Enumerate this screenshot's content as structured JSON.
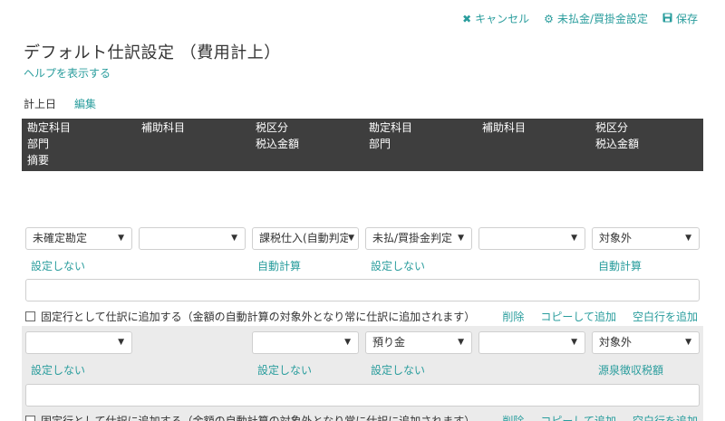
{
  "toolbar": {
    "cancel_label": "キャンセル",
    "unpaid_settings_label": "未払金/買掛金設定",
    "save_label": "保存"
  },
  "page": {
    "title": "デフォルト仕訳設定 （費用計上）",
    "help_label": "ヘルプを表示する",
    "date_label": "計上日",
    "edit_label": "編集"
  },
  "table_header": {
    "debit_account": "勘定科目",
    "debit_sub": "補助科目",
    "debit_tax": "税区分",
    "dept": "部門",
    "tax_included": "税込金額",
    "memo": "摘要",
    "credit_account": "勘定科目",
    "credit_sub": "補助科目",
    "credit_tax": "税区分",
    "credit_dept": "部門",
    "credit_tax_included": "税込金額"
  },
  "rows": [
    {
      "debit_account": "未確定勘定",
      "debit_sub": "",
      "debit_tax": "課税仕入(自動判定",
      "credit_account": "未払/買掛金判定",
      "credit_sub": "",
      "credit_tax": "対象外",
      "debit_dept": "設定しない",
      "debit_amount": "自動計算",
      "credit_dept": "設定しない",
      "credit_amount": "自動計算",
      "fixed_label": "固定行として仕訳に追加する（金額の自動計算の対象外となり常に仕訳に追加されます）",
      "delete_label": "削除",
      "copy_label": "コピーして追加",
      "add_blank_label": "空白行を追加"
    },
    {
      "debit_account": "",
      "debit_tax": "",
      "credit_account": "預り金",
      "credit_sub": "",
      "credit_tax": "対象外",
      "debit_dept": "設定しない",
      "debit_amount": "設定しない",
      "credit_dept": "設定しない",
      "credit_amount": "源泉徴収税額",
      "fixed_label": "固定行として仕訳に追加する（金額の自動計算の対象外となり常に仕訳に追加されます）",
      "delete_label": "削除",
      "copy_label": "コピーして追加",
      "add_blank_label": "空白行を追加"
    }
  ],
  "colors": {
    "accent": "#2a9d9d",
    "header_bg": "#3e3e3e",
    "row_alt_bg": "#ebebeb"
  }
}
